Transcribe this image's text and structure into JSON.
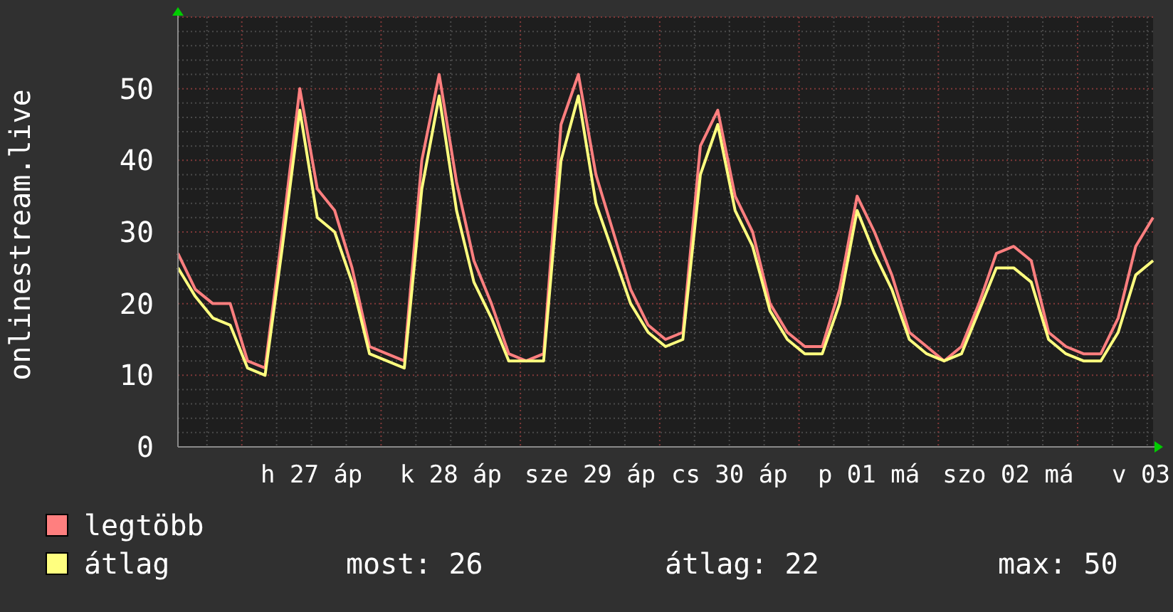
{
  "chart": {
    "y_axis_title": "onlinestream.live",
    "chart_data": {
      "type": "line",
      "categories": [
        null,
        null,
        null,
        null,
        null,
        null,
        null,
        null,
        "h 27 áp",
        null,
        null,
        null,
        null,
        null,
        null,
        null,
        "k 28 áp",
        null,
        null,
        null,
        null,
        null,
        null,
        null,
        "sze 29 áp",
        null,
        null,
        null,
        null,
        null,
        null,
        null,
        "cs 30 áp",
        null,
        null,
        null,
        null,
        null,
        null,
        null,
        "p 01 má",
        null,
        null,
        null,
        null,
        null,
        null,
        null,
        "szo 02 má",
        null,
        null,
        null,
        null,
        null,
        null,
        null,
        "v 03"
      ],
      "series": [
        {
          "name": "legtöbb",
          "color": "#ff7f7f",
          "values": [
            27,
            22,
            20,
            20,
            12,
            11,
            30,
            50,
            36,
            33,
            25,
            14,
            13,
            12,
            40,
            52,
            37,
            26,
            20,
            13,
            12,
            13,
            45,
            52,
            38,
            30,
            22,
            17,
            15,
            16,
            42,
            47,
            35,
            30,
            20,
            16,
            14,
            14,
            22,
            35,
            30,
            24,
            16,
            14,
            12,
            14,
            20,
            27,
            28,
            26,
            16,
            14,
            13,
            13,
            18,
            28,
            32
          ]
        },
        {
          "name": "átlag",
          "color": "#ffff7f",
          "values": [
            25,
            21,
            18,
            17,
            11,
            10,
            28,
            47,
            32,
            30,
            23,
            13,
            12,
            11,
            36,
            49,
            33,
            23,
            18,
            12,
            12,
            12,
            40,
            49,
            34,
            27,
            20,
            16,
            14,
            15,
            38,
            45,
            33,
            28,
            19,
            15,
            13,
            13,
            20,
            33,
            27,
            22,
            15,
            13,
            12,
            13,
            19,
            25,
            25,
            23,
            15,
            13,
            12,
            12,
            16,
            24,
            26
          ]
        }
      ],
      "ylim": [
        0,
        60
      ],
      "grid": true,
      "yticks": [
        0,
        10,
        20,
        30,
        40,
        50
      ]
    }
  },
  "legend": {
    "stats": [
      "most: 26",
      "átlag: 22",
      "max: 50"
    ]
  }
}
